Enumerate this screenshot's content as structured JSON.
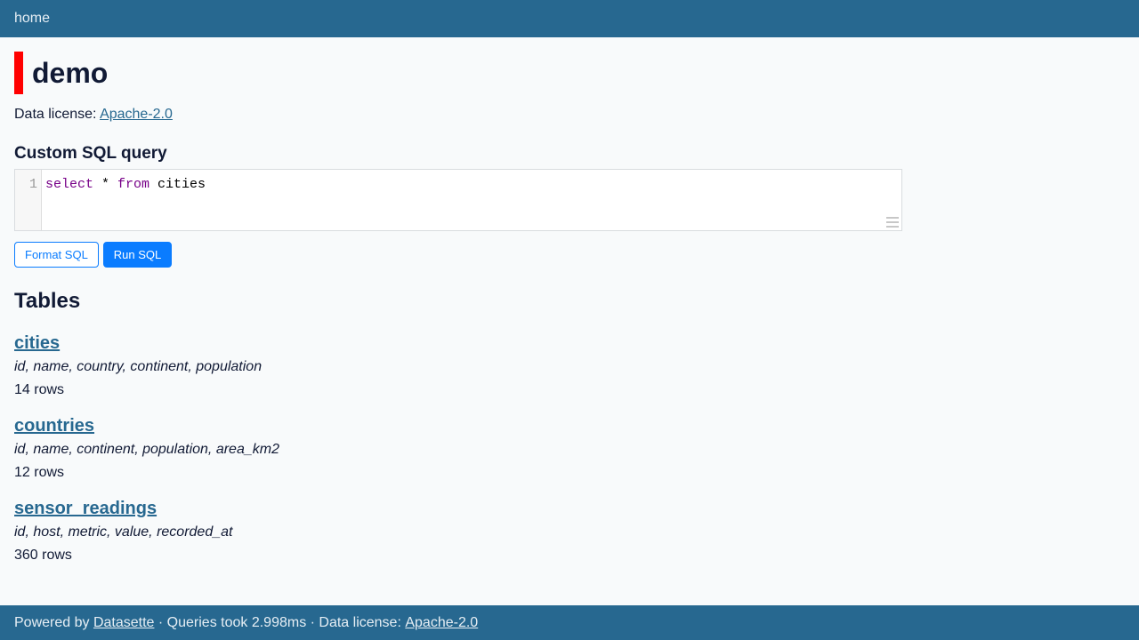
{
  "nav": {
    "home": "home"
  },
  "page": {
    "title": "demo",
    "license_label": "Data license:",
    "license_name": "Apache-2.0"
  },
  "sql": {
    "heading": "Custom SQL query",
    "line_number": "1",
    "kw_select": "select",
    "star": " * ",
    "kw_from": "from",
    "table": " cities",
    "format_button": "Format SQL",
    "run_button": "Run SQL"
  },
  "tables": {
    "heading": "Tables",
    "items": [
      {
        "name": "cities",
        "columns": "id, name, country, continent, population",
        "rows": "14 rows"
      },
      {
        "name": "countries",
        "columns": "id, name, continent, population, area_km2",
        "rows": "12 rows"
      },
      {
        "name": "sensor_readings",
        "columns": "id, host, metric, value, recorded_at",
        "rows": "360 rows"
      }
    ]
  },
  "footer": {
    "powered_by": "Powered by",
    "datasette": "Datasette",
    "queries": "· Queries took 2.998ms · Data license:",
    "license": "Apache-2.0"
  },
  "colors": {
    "header_bg": "#276890",
    "accent_bar": "#ff0000",
    "button_blue": "#0a7cff",
    "keyword": "#770088"
  }
}
